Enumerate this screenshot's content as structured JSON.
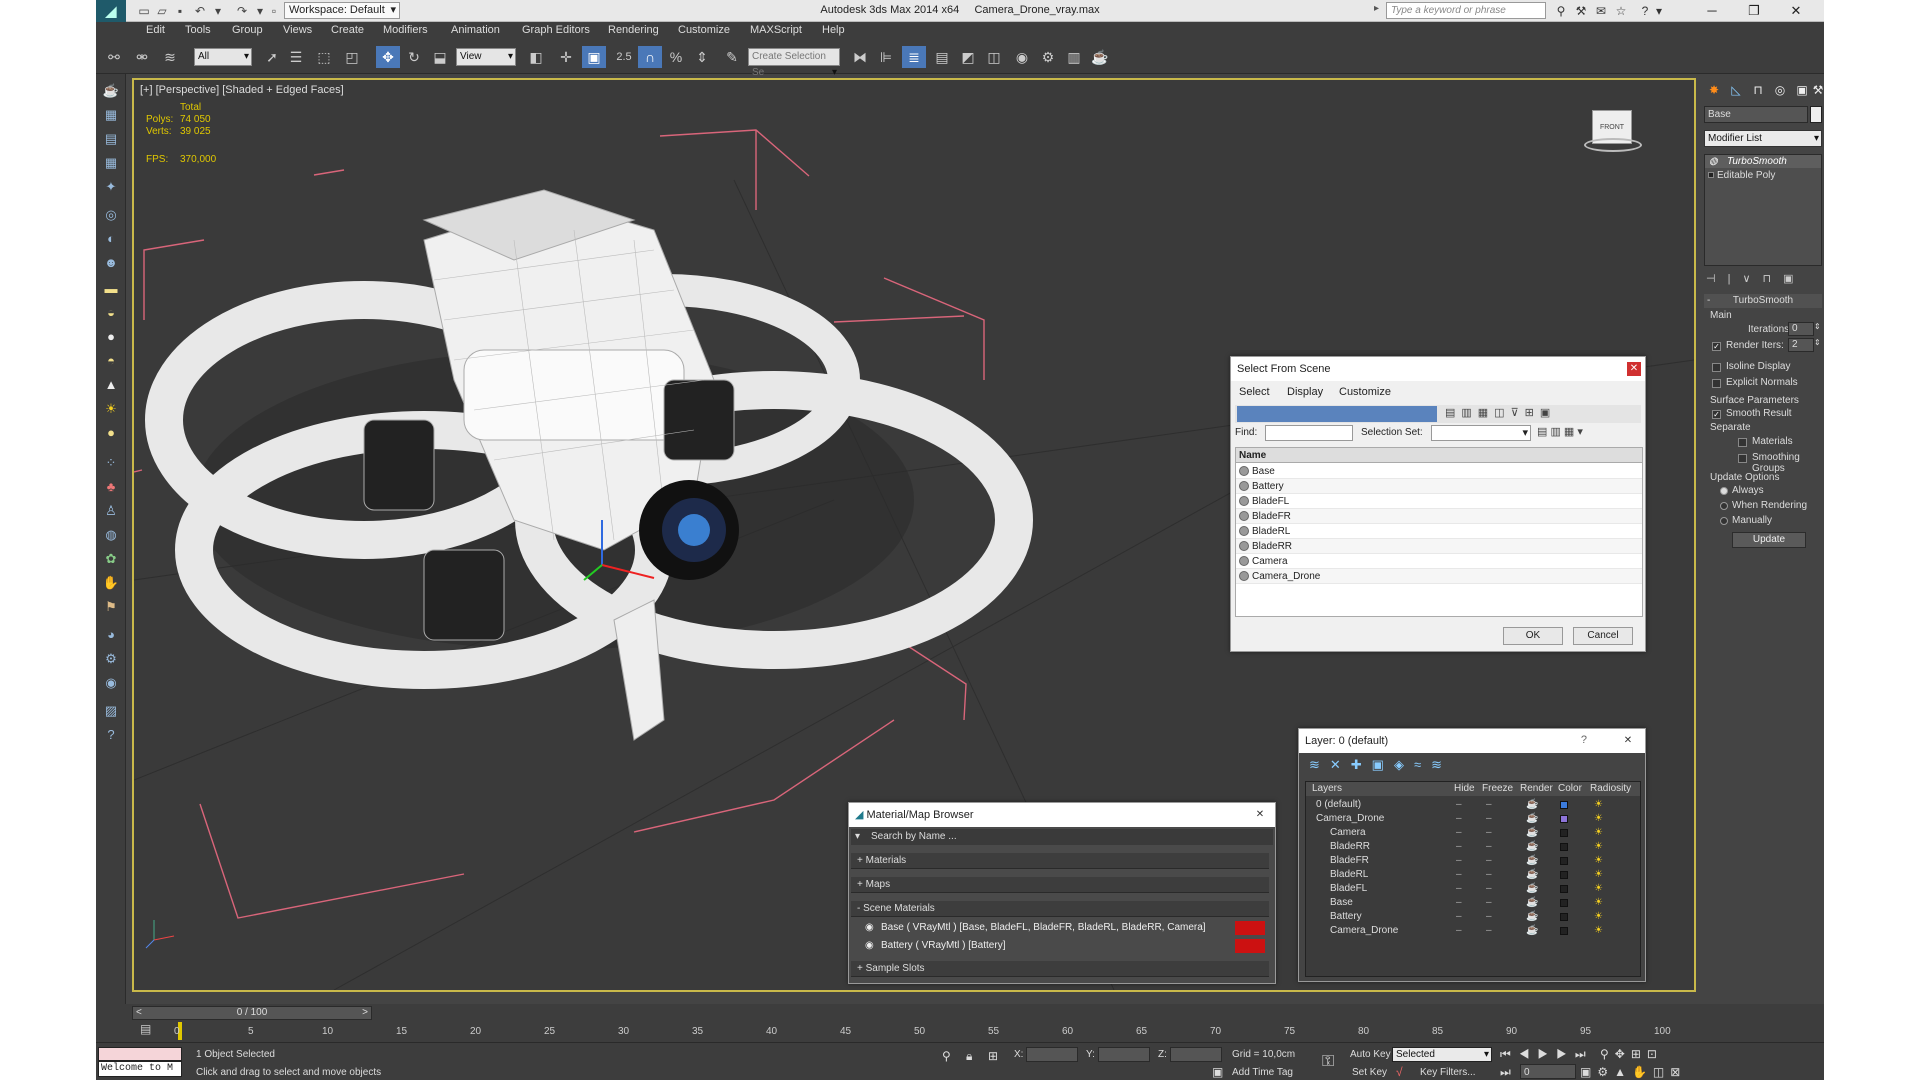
{
  "titlebar": {
    "workspace": "Workspace: Default",
    "app_title": "Autodesk 3ds Max  2014 x64",
    "file_name": "Camera_Drone_vray.max",
    "search_placeholder": "Type a keyword or phrase"
  },
  "menu": [
    "Edit",
    "Tools",
    "Group",
    "Views",
    "Create",
    "Modifiers",
    "Animation",
    "Graph Editors",
    "Rendering",
    "Customize",
    "MAXScript",
    "Help"
  ],
  "toolbar": {
    "filter_value": "All",
    "ref_coord_value": "View",
    "named_selection_placeholder": "Create Selection Se",
    "angle_snap_label": "2.5"
  },
  "viewport": {
    "label": "[+] [Perspective] [Shaded + Edged Faces]",
    "stats": {
      "total_label": "Total",
      "polys_label": "Polys:",
      "polys_value": "74 050",
      "verts_label": "Verts:",
      "verts_value": "39 025",
      "fps_label": "FPS:",
      "fps_value": "370,000"
    },
    "viewcube_label": "FRONT"
  },
  "command_panel": {
    "object_name": "Base",
    "modifier_list_label": "Modifier List",
    "stack": [
      "TurboSmooth",
      "Editable Poly"
    ],
    "turbosmooth": {
      "title": "TurboSmooth",
      "main_label": "Main",
      "iterations_label": "Iterations:",
      "iterations_value": "0",
      "render_iters_label": "Render Iters:",
      "render_iters_value": "2",
      "isoline_label": "Isoline Display",
      "explicit_normals_label": "Explicit Normals",
      "surface_params_label": "Surface Parameters",
      "smooth_result_label": "Smooth Result",
      "separate_label": "Separate",
      "materials_label": "Materials",
      "smoothing_groups_label": "Smoothing Groups",
      "update_options_label": "Update Options",
      "always_label": "Always",
      "when_rendering_label": "When Rendering",
      "manually_label": "Manually",
      "update_button": "Update"
    }
  },
  "select_from_scene": {
    "title": "Select From Scene",
    "menus": [
      "Select",
      "Display",
      "Customize"
    ],
    "find_label": "Find:",
    "selection_set_label": "Selection Set:",
    "column_name": "Name",
    "items": [
      "Base",
      "Battery",
      "BladeFL",
      "BladeFR",
      "BladeRL",
      "BladeRR",
      "Camera",
      "Camera_Drone"
    ],
    "ok_button": "OK",
    "cancel_button": "Cancel"
  },
  "layer_dialog": {
    "title": "Layer: 0 (default)",
    "help": "?",
    "columns": [
      "Layers",
      "Hide",
      "Freeze",
      "Render",
      "Color",
      "Radiosity"
    ],
    "rows": [
      {
        "name": "0 (default)",
        "color": "#3b7bdc"
      },
      {
        "name": "Camera_Drone",
        "color": "#8d74d8"
      },
      {
        "name": "Camera",
        "color": "#222222"
      },
      {
        "name": "BladeRR",
        "color": "#222222"
      },
      {
        "name": "BladeFR",
        "color": "#222222"
      },
      {
        "name": "BladeRL",
        "color": "#222222"
      },
      {
        "name": "BladeFL",
        "color": "#222222"
      },
      {
        "name": "Base",
        "color": "#222222"
      },
      {
        "name": "Battery",
        "color": "#222222"
      },
      {
        "name": "Camera_Drone",
        "color": "#222222"
      }
    ]
  },
  "material_browser": {
    "title": "Material/Map Browser",
    "search_placeholder": "Search by Name ...",
    "sections": [
      "+ Materials",
      "+ Maps",
      "- Scene Materials",
      "+ Sample Slots"
    ],
    "scene_materials": [
      "Base  ( VRayMtl )  [Base, BladeFL, BladeFR, BladeRL, BladeRR, Camera]",
      "Battery  ( VRayMtl )  [Battery]"
    ]
  },
  "timeline": {
    "frame_counter": "0 / 100",
    "ticks": [
      "0",
      "5",
      "10",
      "15",
      "20",
      "25",
      "30",
      "35",
      "40",
      "45",
      "50",
      "55",
      "60",
      "65",
      "70",
      "75",
      "80",
      "85",
      "90",
      "95",
      "100"
    ]
  },
  "status": {
    "script_listener": "Welcome to M",
    "selection": "1 Object Selected",
    "prompt": "Click and drag to select and move objects",
    "x_label": "X:",
    "y_label": "Y:",
    "z_label": "Z:",
    "grid": "Grid = 10,0cm",
    "add_time_tag": "Add Time Tag",
    "auto_key": "Auto Key",
    "set_key": "Set Key",
    "selected_value": "Selected",
    "key_filters": "Key Filters...",
    "frame_value": "0"
  },
  "colors": {
    "viewport_border": "#c9b94a",
    "accent": "#4a78b8",
    "material_swatch": "#cc1111",
    "stats_text": "#e0c800"
  }
}
